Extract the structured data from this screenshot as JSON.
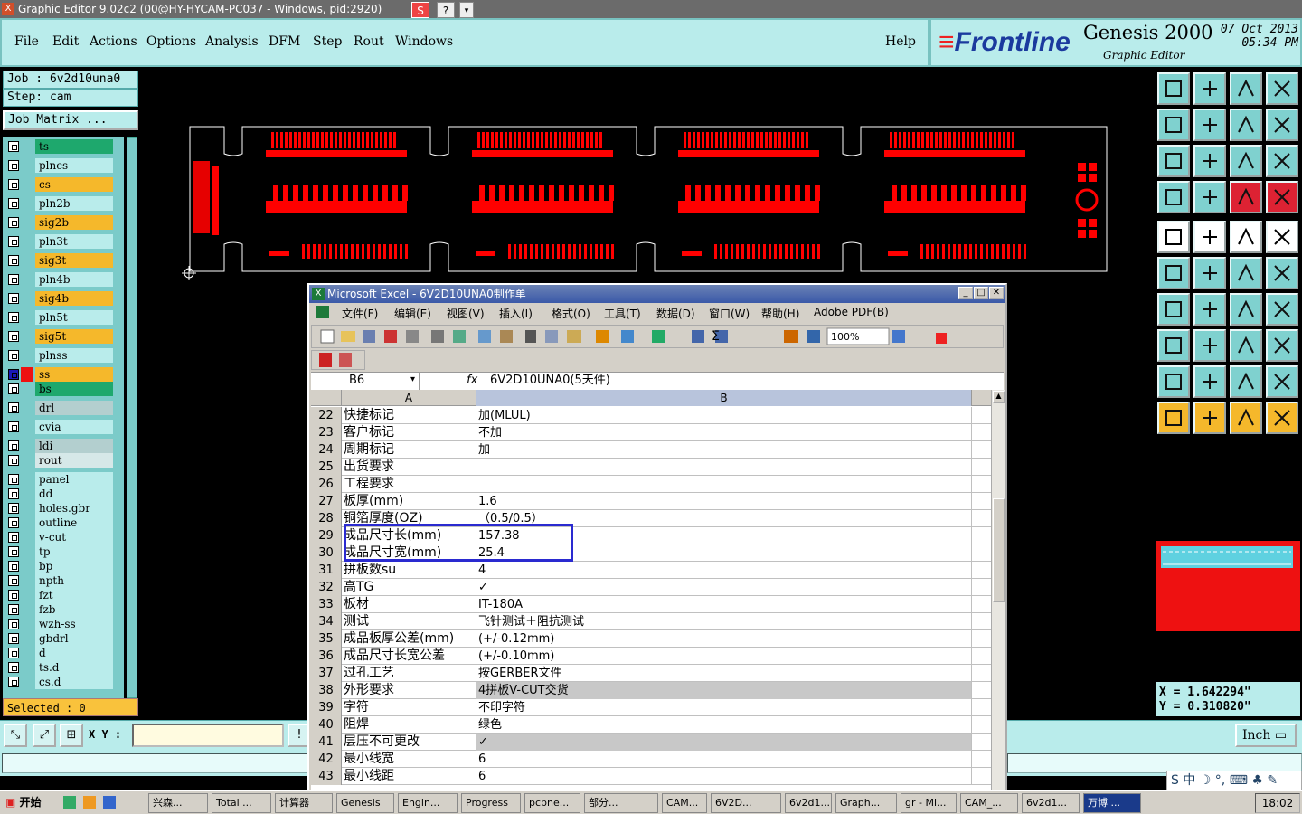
{
  "window": {
    "title": "Graphic Editor 9.02c2 (00@HY-HYCAM-PC037 - Windows, pid:2920)",
    "icon_text": "X",
    "s_button": "S",
    "help_button": "?",
    "drop_button": "▾"
  },
  "menu": [
    "File",
    "Edit",
    "Actions",
    "Options",
    "Analysis",
    "DFM",
    "Step",
    "Rout",
    "Windows"
  ],
  "help": "Help",
  "brand": {
    "logo_mark": "≡",
    "logo": "Frontline",
    "product": "Genesis 2000",
    "subtitle": "Graphic Editor",
    "date": "07 Oct 2013",
    "time": "05:34 PM"
  },
  "job": {
    "job_line": "Job : 6v2d10una0",
    "step_line": "Step: cam",
    "matrix": "Job Matrix ..."
  },
  "layers": [
    {
      "name": "ts",
      "color": "#1ea86d"
    },
    {
      "name": "plncs",
      "color": "#b9eceb"
    },
    {
      "name": "cs",
      "color": "#f5b82b"
    },
    {
      "name": "pln2b",
      "color": "#b9eceb"
    },
    {
      "name": "sig2b",
      "color": "#f5b82b"
    },
    {
      "name": "pln3t",
      "color": "#b9eceb"
    },
    {
      "name": "sig3t",
      "color": "#f5b82b"
    },
    {
      "name": "pln4b",
      "color": "#b9eceb"
    },
    {
      "name": "sig4b",
      "color": "#f5b82b"
    },
    {
      "name": "pln5t",
      "color": "#b9eceb"
    },
    {
      "name": "sig5t",
      "color": "#f5b82b"
    },
    {
      "name": "plnss",
      "color": "#b9eceb"
    },
    {
      "name": "ss",
      "color": "#f5b82b"
    },
    {
      "name": "bs",
      "color": "#1ea86d"
    },
    {
      "name": "drl",
      "color": "#b3cfcf"
    },
    {
      "name": "cvia",
      "color": "#b9eceb"
    },
    {
      "name": "ldi",
      "color": "#b3cfcf"
    },
    {
      "name": "rout",
      "color": "#d6e8e8"
    },
    {
      "name": "panel",
      "color": "#b9eceb"
    },
    {
      "name": "dd",
      "color": "#b9eceb"
    },
    {
      "name": "holes.gbr",
      "color": "#b9eceb"
    },
    {
      "name": "outline",
      "color": "#b9eceb"
    },
    {
      "name": "v-cut",
      "color": "#b9eceb"
    },
    {
      "name": "tp",
      "color": "#b9eceb"
    },
    {
      "name": "bp",
      "color": "#b9eceb"
    },
    {
      "name": "npth",
      "color": "#b9eceb"
    },
    {
      "name": "fzt",
      "color": "#b9eceb"
    },
    {
      "name": "fzb",
      "color": "#b9eceb"
    },
    {
      "name": "wzh-ss",
      "color": "#b9eceb"
    },
    {
      "name": "gbdrl",
      "color": "#b9eceb"
    },
    {
      "name": "d",
      "color": "#b9eceb"
    },
    {
      "name": "ts.d",
      "color": "#b9eceb"
    },
    {
      "name": "cs.d",
      "color": "#b9eceb"
    }
  ],
  "selected": "Selected : 0",
  "xy": {
    "label": "X Y :",
    "value": ""
  },
  "units": "Inch",
  "coords": {
    "x": "X = 1.642294\"",
    "y": "Y = 0.310820\""
  },
  "excel": {
    "title": "Microsoft Excel - 6V2D10UNA0制作单",
    "icon_text": "X",
    "menu": [
      "文件(F)",
      "编辑(E)",
      "视图(V)",
      "插入(I)",
      "格式(O)",
      "工具(T)",
      "数据(D)",
      "窗口(W)",
      "帮助(H)",
      "Adobe PDF(B)"
    ],
    "zoom": "100%",
    "namebox": "B6",
    "fx": "fx",
    "formula": "6V2D10UNA0(5天件)",
    "col_a": "A",
    "col_b": "B",
    "rows": [
      {
        "n": "22",
        "a": "快捷标记",
        "b": "加(MLUL)"
      },
      {
        "n": "23",
        "a": "客户标记",
        "b": "不加"
      },
      {
        "n": "24",
        "a": "周期标记",
        "b": "加"
      },
      {
        "n": "25",
        "a": "出货要求",
        "b": ""
      },
      {
        "n": "26",
        "a": "工程要求",
        "b": ""
      },
      {
        "n": "27",
        "a": "板厚(mm)",
        "b": "1.6"
      },
      {
        "n": "28",
        "a": "铜箔厚度(OZ)",
        "b": "（0.5/0.5）"
      },
      {
        "n": "29",
        "a": "成品尺寸长(mm)",
        "b": "157.38"
      },
      {
        "n": "30",
        "a": "成品尺寸宽(mm)",
        "b": "25.4"
      },
      {
        "n": "31",
        "a": "拼板数su",
        "b": "4"
      },
      {
        "n": "32",
        "a": "高TG",
        "b": "✓"
      },
      {
        "n": "33",
        "a": "板材",
        "b": "IT-180A"
      },
      {
        "n": "34",
        "a": "测试",
        "b": "飞针测试＋阻抗测试"
      },
      {
        "n": "35",
        "a": "成品板厚公差(mm)",
        "b": "(+/-0.12mm)"
      },
      {
        "n": "36",
        "a": "成品尺寸长宽公差",
        "b": "(+/-0.10mm)"
      },
      {
        "n": "37",
        "a": "过孔工艺",
        "b": "按GERBER文件"
      },
      {
        "n": "38",
        "a": "外形要求",
        "b": "4拼板V-CUT交货"
      },
      {
        "n": "39",
        "a": "字符",
        "b": "不印字符"
      },
      {
        "n": "40",
        "a": "阻焊",
        "b": "绿色"
      },
      {
        "n": "41",
        "a": "层压不可更改",
        "b": "✓"
      },
      {
        "n": "42",
        "a": "最小线宽",
        "b": "6"
      },
      {
        "n": "43",
        "a": "最小线距",
        "b": "6"
      }
    ]
  },
  "taskbar": {
    "start": "开始",
    "tasks": [
      "兴森...",
      "Total ...",
      "计算器",
      "Genesis",
      "Engin...",
      "Progress",
      "pcbne...",
      "部分...",
      "CAM...",
      "6V2D...",
      "6v2d1...",
      "Graph...",
      "gr - Mi...",
      "CAM_...",
      "6v2d1...",
      "万博 ..."
    ],
    "clock": "18:02"
  },
  "ime": "S 中 ☽ °, ⌨ ♣ ✎",
  "colors": {
    "accent_panel": "#b9eceb",
    "pcb": "#ff0000",
    "selection": "#2a2ad0"
  }
}
